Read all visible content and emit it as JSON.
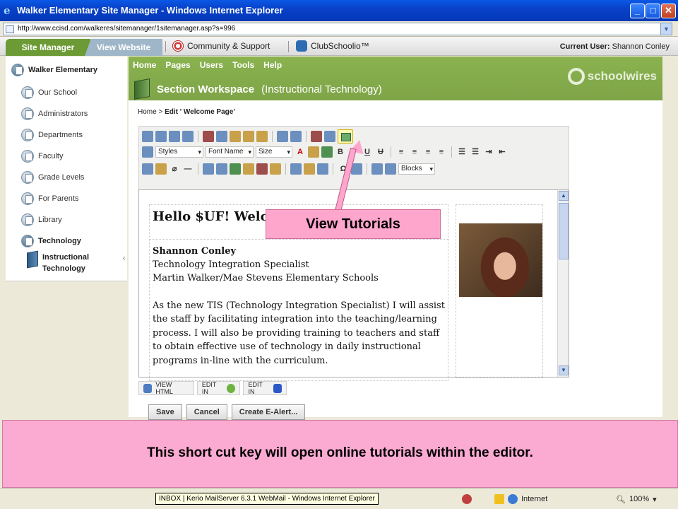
{
  "window": {
    "title": "Walker Elementary Site Manager - Windows Internet Explorer",
    "minimize": "_",
    "maximize": "□",
    "close": "✕"
  },
  "address": {
    "url": "http://www.ccisd.com/walkeres/sitemanager/1sitemanager.asp?s=996"
  },
  "topnav": {
    "tab_site_manager": "Site Manager",
    "tab_view_website": "View Website",
    "community": "Community & Support",
    "clubschoolio": "ClubSchoolio™",
    "current_user_label": "Current User:",
    "current_user": "Shannon Conley"
  },
  "sidebar": {
    "home": "Walker Elementary",
    "items": [
      {
        "label": "Our School"
      },
      {
        "label": "Administrators"
      },
      {
        "label": "Departments"
      },
      {
        "label": "Faculty"
      },
      {
        "label": "Grade Levels"
      },
      {
        "label": "For Parents"
      },
      {
        "label": "Library"
      },
      {
        "label": "Technology"
      }
    ],
    "subitem": "Instructional Technology"
  },
  "main": {
    "menu": [
      "Home",
      "Pages",
      "Users",
      "Tools",
      "Help"
    ],
    "workspace_title": "Section Workspace",
    "workspace_sub": "(Instructional Technology)",
    "brand": "schoolwires",
    "breadcrumb_home": "Home",
    "breadcrumb_sep": ">",
    "breadcrumb_current": "Edit ' Welcome Page'"
  },
  "editor": {
    "styles": "Styles",
    "font_name": "Font Name",
    "size": "Size",
    "blocks": "Blocks",
    "bold": "B",
    "italic": "I",
    "underline": "U",
    "omega": "Ω"
  },
  "content": {
    "heading": "Hello $UF! Welc",
    "lines": [
      "Shannon Conley",
      "Technology Integration Specialist",
      "Martin Walker/Mae Stevens Elementary Schools",
      "",
      "As the new TIS (Technology Integration Specialist) I will assist",
      "the staff by facilitating integration into the teaching/learning",
      "process. I will also be providing training to teachers and staff",
      "to obtain effective use of technology in daily instructional",
      "programs in-line with the curriculum."
    ]
  },
  "modes": {
    "view_html": "VIEW HTML",
    "edit_in_1": "EDIT IN",
    "edit_in_2": "EDIT IN"
  },
  "buttons": {
    "save": "Save",
    "cancel": "Cancel",
    "alert": "Create E-Alert..."
  },
  "callout": "View Tutorials",
  "banner": "This short cut key will open online tutorials within the editor.",
  "status": {
    "zone": "Internet",
    "zoom": "100%",
    "taskbar_tooltip": "INBOX | Kerio MailServer 6.3.1 WebMail - Windows Internet Explorer"
  }
}
